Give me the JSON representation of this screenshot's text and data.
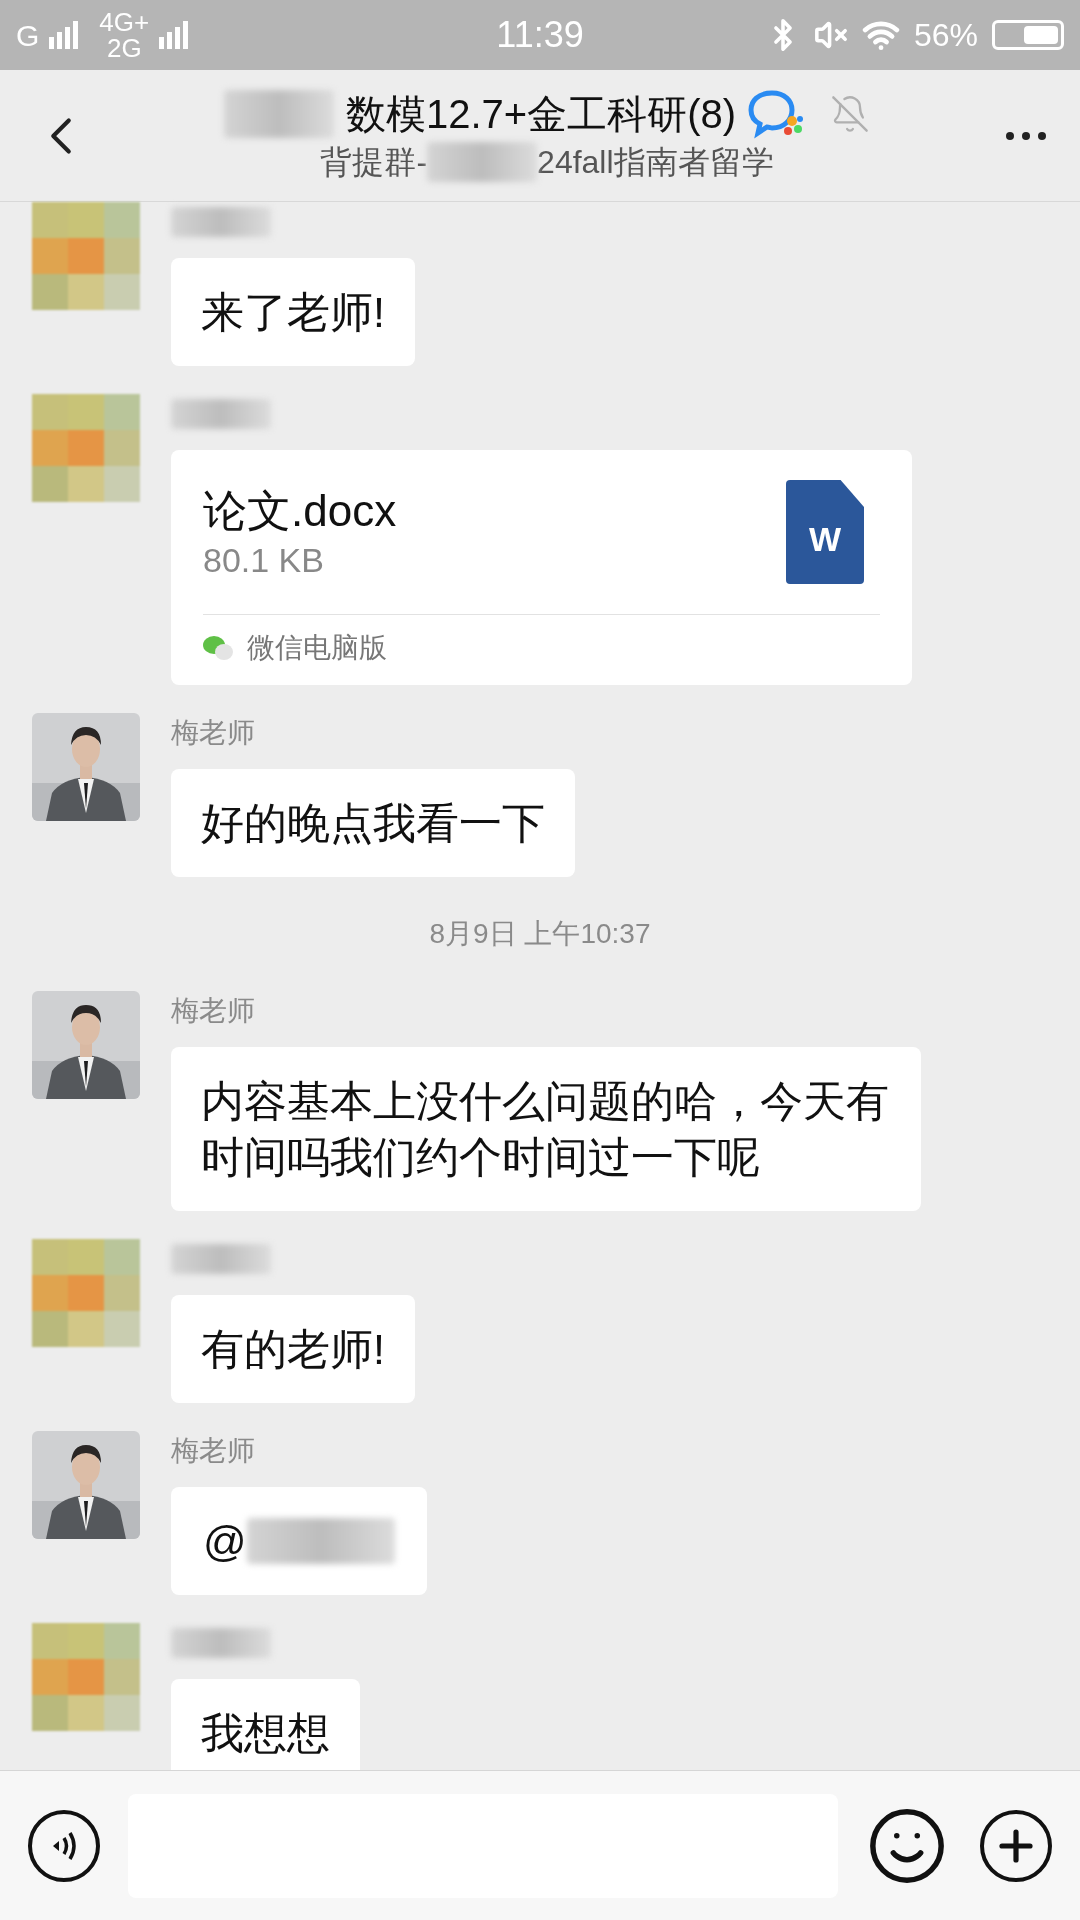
{
  "status_bar": {
    "network_1": "G",
    "network_2": "4G+",
    "network_3": "2G",
    "time": "11:39",
    "battery": "56%"
  },
  "header": {
    "title": "数模12.7+金工科研(8)",
    "subtitle_prefix": "背提群-",
    "subtitle_suffix": "24fall指南者留学",
    "muted": true
  },
  "messages": [
    {
      "kind": "text",
      "sender": {
        "kind": "hidden"
      },
      "text": "来了老师!"
    },
    {
      "kind": "file",
      "sender": {
        "kind": "hidden"
      },
      "file_name": "论文.docx",
      "size": "80.1 KB",
      "icon_label": "W",
      "source": "微信电脑版"
    },
    {
      "kind": "text",
      "sender": {
        "kind": "named",
        "name": "梅老师"
      },
      "text": "好的晚点我看一下"
    },
    {
      "kind": "time",
      "text": "8月9日 上午10:37"
    },
    {
      "kind": "text",
      "sender": {
        "kind": "named",
        "name": "梅老师"
      },
      "text": "内容基本上没什么问题的哈，今天有时间吗我们约个时间过一下呢"
    },
    {
      "kind": "text",
      "sender": {
        "kind": "hidden"
      },
      "text": "有的老师!"
    },
    {
      "kind": "mention",
      "sender": {
        "kind": "named",
        "name": "梅老师"
      },
      "text": "@"
    },
    {
      "kind": "text",
      "sender": {
        "kind": "hidden"
      },
      "text": "我想想"
    }
  ]
}
